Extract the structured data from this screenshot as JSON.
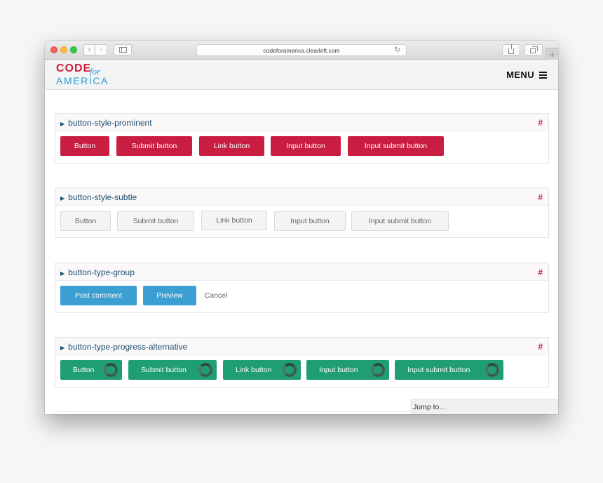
{
  "browser": {
    "url": "codeforamerica.clearleft.com",
    "back_glyph": "‹",
    "forward_glyph": "›",
    "reload_glyph": "↻",
    "new_tab_glyph": "+"
  },
  "header": {
    "logo_code": "CODE",
    "logo_for": "for",
    "logo_america": "AMERICA",
    "menu_label": "MENU"
  },
  "colors": {
    "brand_red": "#c91d41",
    "brand_blue": "#2b9bd5",
    "group_blue": "#3b9fd1",
    "progress_green": "#1f9e75"
  },
  "sections": [
    {
      "title": "button-style-prominent",
      "hash": "#",
      "buttons": [
        "Button",
        "Submit button",
        "Link button",
        "Input button",
        "Input submit button"
      ]
    },
    {
      "title": "button-style-subtle",
      "hash": "#",
      "buttons": [
        "Button",
        "Submit button",
        "Link button",
        "Input button",
        "Input submit button"
      ]
    },
    {
      "title": "button-type-group",
      "hash": "#",
      "buttons": [
        "Post comment",
        "Preview",
        "Cancel"
      ]
    },
    {
      "title": "button-type-progress-alternative",
      "hash": "#",
      "buttons": [
        "Button",
        "Submit button",
        "Link button",
        "Input button",
        "Input submit button"
      ]
    }
  ],
  "jump_to": "Jump to..."
}
